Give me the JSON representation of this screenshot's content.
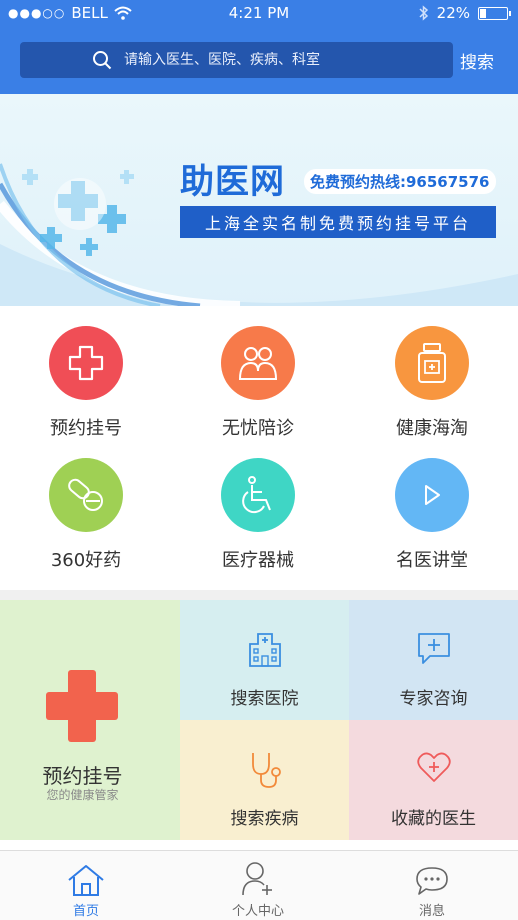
{
  "status_bar": {
    "carrier": "BELL",
    "time": "4:21 PM",
    "battery": "22%",
    "signal_dots": "●●●○○"
  },
  "search": {
    "placeholder": "请输入医生、医院、疾病、科室",
    "button_label": "搜索"
  },
  "banner": {
    "brand": "助医网",
    "hotline": "免费预约热线:96567576",
    "slogan": "上海全实名制免费预约挂号平台"
  },
  "grid": [
    {
      "label": "预约挂号",
      "icon": "cross-icon",
      "color": "#f04e56"
    },
    {
      "label": "无忧陪诊",
      "icon": "people-icon",
      "color": "#f77a4a"
    },
    {
      "label": "健康海淘",
      "icon": "medicine-bottle-icon",
      "color": "#f8963f"
    },
    {
      "label": "360好药",
      "icon": "pills-icon",
      "color": "#9fd054"
    },
    {
      "label": "医疗器械",
      "icon": "wheelchair-icon",
      "color": "#3fd6c5"
    },
    {
      "label": "名医讲堂",
      "icon": "play-icon",
      "color": "#63b7f5"
    }
  ],
  "tiles": {
    "big": {
      "title": "预约挂号",
      "subtitle": "您的健康管家",
      "color": "#dff2cf"
    },
    "items": [
      {
        "label": "搜索医院",
        "icon": "hospital-icon",
        "color": "#d6eef0"
      },
      {
        "label": "专家咨询",
        "icon": "chat-plus-icon",
        "color": "#d2e5f3"
      },
      {
        "label": "搜索疾病",
        "icon": "stethoscope-icon",
        "color": "#f9efd0"
      },
      {
        "label": "收藏的医生",
        "icon": "heart-plus-icon",
        "color": "#f4dade"
      }
    ]
  },
  "tabbar": [
    {
      "label": "首页",
      "icon": "home-icon",
      "active": true
    },
    {
      "label": "个人中心",
      "icon": "user-plus-icon",
      "active": false
    },
    {
      "label": "消息",
      "icon": "message-icon",
      "active": false
    }
  ],
  "colors": {
    "primary": "#3a7fe6",
    "search_bg": "#2456ad",
    "tab_active": "#2f7be5"
  }
}
